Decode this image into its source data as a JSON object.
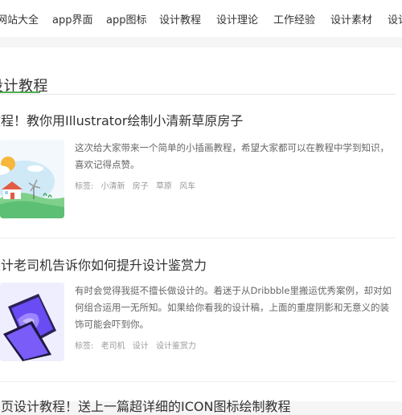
{
  "nav": {
    "items": [
      "网站大全",
      "app界面",
      "app图标",
      "设计教程",
      "设计理论",
      "工作经验",
      "设计素材",
      "设计"
    ]
  },
  "section": {
    "title": "设计教程"
  },
  "articles": [
    {
      "title": "教程！教你用Illustrator绘制小清新草原房子",
      "description": "这次给大家带来一个简单的小插画教程，希望大家都可以在教程中学到知识，喜欢记得点赞。",
      "tags_label": "标签:",
      "tags": [
        "小清新",
        "房子",
        "草原",
        "风车"
      ]
    },
    {
      "title": "设计老司机告诉你如何提升设计鉴赏力",
      "description": "有时会觉得我挺不擅长做设计的。着迷于从Dribbble里搬运优秀案例，却对如何组合运用一无所知。如果给你看我的设计稿，上面的重度阴影和无意义的装饰可能会吓到你。",
      "tags_label": "标签:",
      "tags": [
        "老司机",
        "设计",
        "设计鉴赏力"
      ]
    },
    {
      "title": "网页设计教程！送上一篇超详细的ICON图标绘制教程"
    }
  ],
  "colors": {
    "accent": "#4caf50",
    "sky": "#bfe6f5",
    "sun": "#f6b73c",
    "grass": "#7fd08a",
    "house_roof": "#e25b45",
    "phone_purple": "#6a4cf5"
  }
}
